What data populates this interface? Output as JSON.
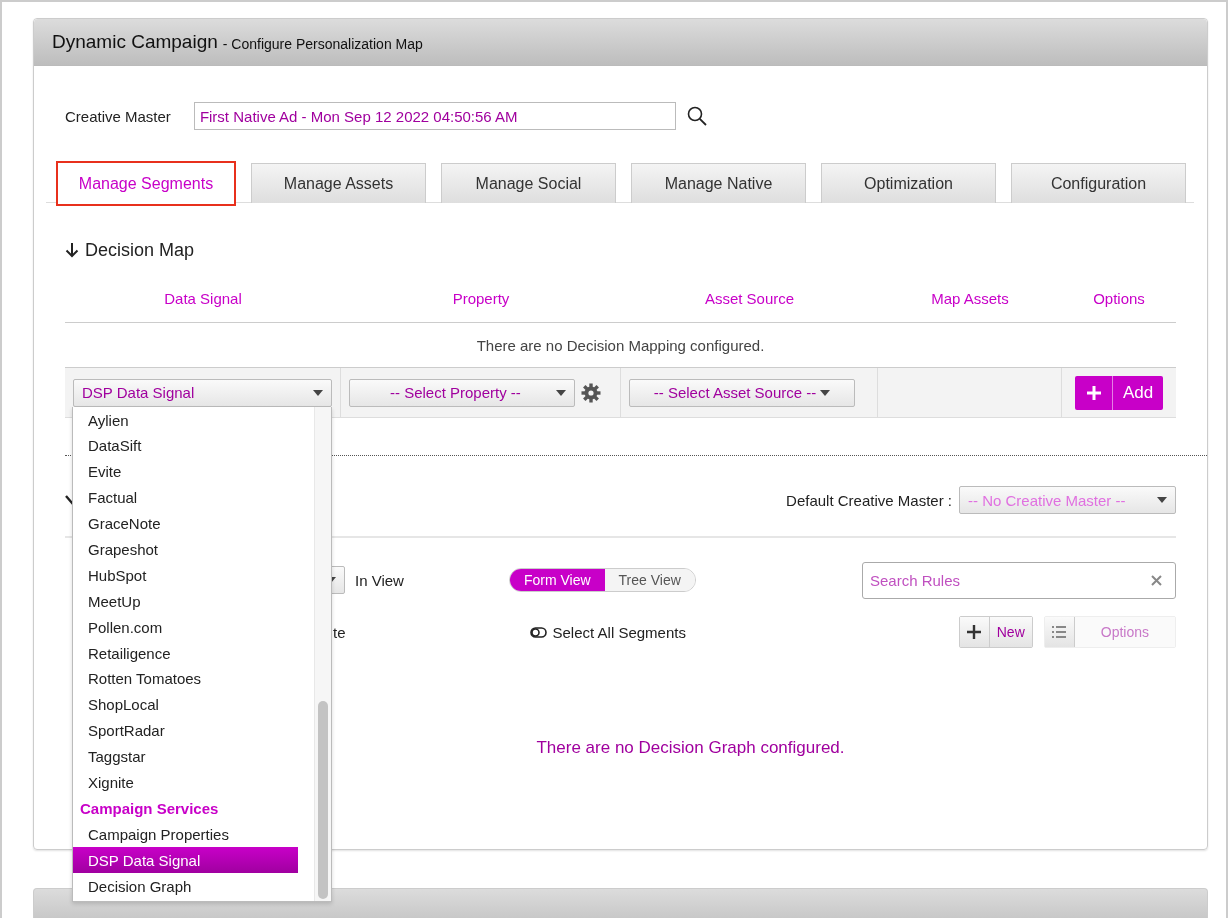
{
  "header": {
    "title": "Dynamic Campaign",
    "subtitle": "- Configure Personalization Map"
  },
  "creative_master": {
    "label": "Creative Master",
    "value": "First Native Ad - Mon Sep 12 2022 04:50:56 AM"
  },
  "tabs": [
    {
      "label": "Manage Segments",
      "selected": true
    },
    {
      "label": "Manage Assets",
      "selected": false
    },
    {
      "label": "Manage Social",
      "selected": false
    },
    {
      "label": "Manage Native",
      "selected": false
    },
    {
      "label": "Optimization",
      "selected": false
    },
    {
      "label": "Configuration",
      "selected": false
    }
  ],
  "decision_map": {
    "title": "Decision Map",
    "columns": [
      "Data Signal",
      "Property",
      "Asset Source",
      "Map Assets",
      "Options"
    ],
    "empty_message": "There are no Decision Mapping configured.",
    "signal_select": {
      "value": "DSP Data Signal",
      "expanded": true
    },
    "property_select": "-- Select Property --",
    "asset_source_select": "-- Select Asset Source --",
    "add_button": "Add"
  },
  "signal_menu": [
    {
      "kind": "option",
      "label": "Aylien",
      "selected": false
    },
    {
      "kind": "option",
      "label": "DataSift",
      "selected": false
    },
    {
      "kind": "option",
      "label": "Evite",
      "selected": false
    },
    {
      "kind": "option",
      "label": "Factual",
      "selected": false
    },
    {
      "kind": "option",
      "label": "GraceNote",
      "selected": false
    },
    {
      "kind": "option",
      "label": "Grapeshot",
      "selected": false
    },
    {
      "kind": "option",
      "label": "HubSpot",
      "selected": false
    },
    {
      "kind": "option",
      "label": "MeetUp",
      "selected": false
    },
    {
      "kind": "option",
      "label": "Pollen.com",
      "selected": false
    },
    {
      "kind": "option",
      "label": "Retailigence",
      "selected": false
    },
    {
      "kind": "option",
      "label": "Rotten Tomatoes",
      "selected": false
    },
    {
      "kind": "option",
      "label": "ShopLocal",
      "selected": false
    },
    {
      "kind": "option",
      "label": "SportRadar",
      "selected": false
    },
    {
      "kind": "option",
      "label": "Taggstar",
      "selected": false
    },
    {
      "kind": "option",
      "label": "Xignite",
      "selected": false
    },
    {
      "kind": "group",
      "label": "Campaign Services"
    },
    {
      "kind": "option",
      "label": "Campaign Properties",
      "selected": false
    },
    {
      "kind": "option",
      "label": "DSP Data Signal",
      "selected": true
    },
    {
      "kind": "option",
      "label": "Decision Graph",
      "selected": false
    }
  ],
  "decision_graph": {
    "default_master_label": "Default Creative Master :",
    "default_master_value": "-- No Creative Master --",
    "in_view_label": "In View",
    "view_toggle": [
      {
        "label": "Form View",
        "selected": true
      },
      {
        "label": "Tree View",
        "selected": false
      }
    ],
    "search_placeholder": "Search Rules",
    "partial_label": "te",
    "select_all": "Select All Segments",
    "new_button": "New",
    "options_button": {
      "label": "Options",
      "disabled": true
    },
    "empty_message": "There are no Decision Graph configured."
  }
}
